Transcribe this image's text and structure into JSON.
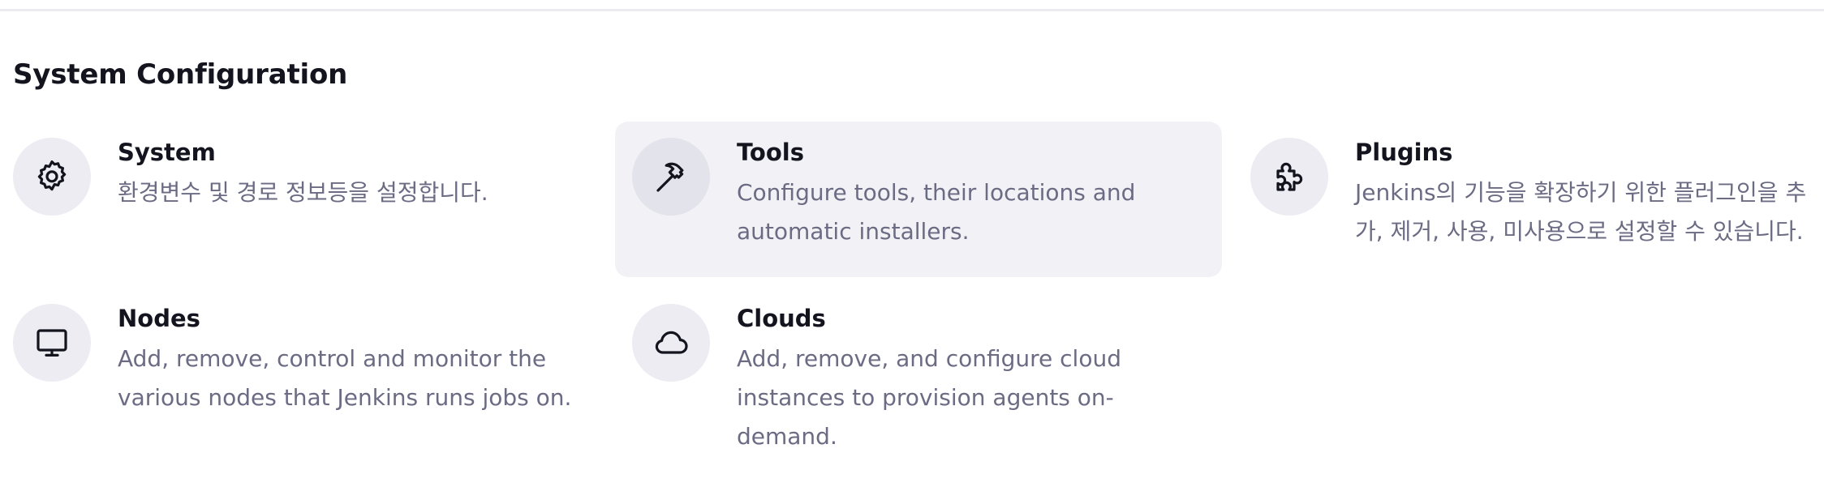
{
  "section": {
    "title": "System Configuration"
  },
  "cards": [
    {
      "title": "System",
      "description": "환경변수 및 경로 정보등을 설정합니다.",
      "icon": "gear-icon"
    },
    {
      "title": "Tools",
      "description": "Configure tools, their locations and automatic installers.",
      "icon": "hammer-icon"
    },
    {
      "title": "Plugins",
      "description": "Jenkins의 기능을 확장하기 위한 플러그인을 추가, 제거, 사용, 미사용으로 설정할 수 있습니다.",
      "icon": "puzzle-icon"
    },
    {
      "title": "Nodes",
      "description": "Add, remove, control and monitor the various nodes that Jenkins runs jobs on.",
      "icon": "monitor-icon"
    },
    {
      "title": "Clouds",
      "description": "Add, remove, and configure cloud instances to provision agents on-demand.",
      "icon": "cloud-icon"
    }
  ],
  "colors": {
    "title": "#14141f",
    "description": "#6b6b84",
    "icon_bg": "#ececf2",
    "hover_bg": "#f2f2f6"
  }
}
